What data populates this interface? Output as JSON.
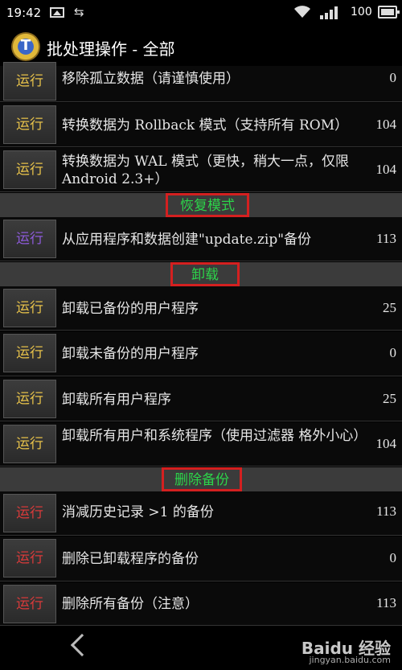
{
  "status_bar": {
    "time": "19:42",
    "battery": "100"
  },
  "title_bar": {
    "icon_letter": "T",
    "title": "批处理操作 - 全部"
  },
  "items": [
    {
      "button": "运行",
      "label": "移除孤立数据（请谨慎使用）",
      "count": "0"
    },
    {
      "button": "运行",
      "label": "转换数据为 Rollback 模式（支持所有 ROM）",
      "count": "104"
    },
    {
      "button": "运行",
      "label": "转换数据为 WAL 模式（更快，稍大一点，仅限 Android 2.3+）",
      "count": "104"
    },
    {
      "button": "运行",
      "label": "从应用程序和数据创建\"update.zip\"备份",
      "count": "113"
    },
    {
      "button": "运行",
      "label": "卸载已备份的用户程序",
      "count": "25"
    },
    {
      "button": "运行",
      "label": "卸载未备份的用户程序",
      "count": "0"
    },
    {
      "button": "运行",
      "label": "卸载所有用户程序",
      "count": "25"
    },
    {
      "button": "运行",
      "label": "卸载所有用户和系统程序（使用过滤器 格外小心）",
      "count": "104"
    },
    {
      "button": "运行",
      "label": "消减历史记录 >1 的备份",
      "count": "113"
    },
    {
      "button": "运行",
      "label": "删除已卸载程序的备份",
      "count": "0"
    },
    {
      "button": "运行",
      "label": "删除所有备份（注意）",
      "count": "113"
    }
  ],
  "sections": {
    "recovery": "恢复模式",
    "uninstall": "卸载",
    "delete_backup": "删除备份"
  },
  "watermark": {
    "brand": "Baidu 经验",
    "url": "jingyan.baidu.com"
  },
  "colors": {
    "section_text": "#2cd44a",
    "highlight_border": "#d42020",
    "run_yellow": "#e6c14a",
    "run_purple": "#8c5ad8",
    "run_red": "#d83a3a"
  }
}
